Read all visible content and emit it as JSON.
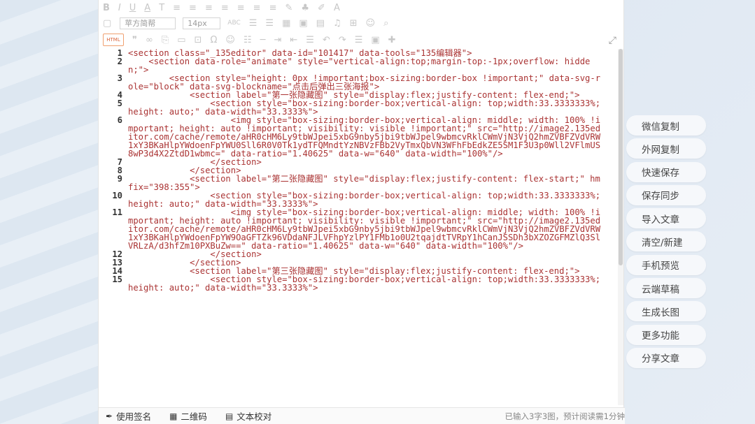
{
  "toolbar": {
    "row1": [
      "B",
      "I",
      "U",
      "A",
      "T",
      "≡",
      "≡",
      "≡",
      "≡",
      "≡",
      "≡",
      "≡",
      "✎",
      "♣",
      "✐",
      "A"
    ],
    "font_family": "苹方简帮",
    "font_size": "14px",
    "abc": "ABC",
    "html_badge": "HTML"
  },
  "code_lines": [
    {
      "n": "1",
      "text": "<section class=\"_135editor\" data-id=\"101417\" data-tools=\"135编辑器\">"
    },
    {
      "n": "2",
      "text": "    <section data-role=\"animate\" style=\"vertical-align:top;margin-top:-1px;overflow: hidden;\">"
    },
    {
      "n": "3",
      "text": "        <section style=\"height: 0px !important;box-sizing:border-box !important;\" data-svg-role=\"block\" data-svg-blockname=\"点击后弹出三张海报\">"
    },
    {
      "n": "4",
      "text": "            <section label=\"第一张隐藏图\" style=\"display:flex;justify-content: flex-end;\">"
    },
    {
      "n": "5",
      "text": "                <section style=\"box-sizing:border-box;vertical-align: top;width:33.3333333%;height: auto;\" data-width=\"33.3333%\">"
    },
    {
      "n": "6",
      "text": "                    <img style=\"box-sizing:border-box;vertical-align: middle; width: 100% !important; height: auto !important; visibility: visible !important;\" src=\"http://image2.135editor.com/cache/remote/aHR0cHM6Ly9tbWJpei5xbG9nby5jbi9tbWJpel9wbmcvRklCWmVjN3VjQ2hmZVBFZVdVRW1xY3BKaHlpYWdoenFpYWU0Sll6R0V0Tk1ydTFQMndtYzNBVzFBb2VyTmxQbVN3WFhFbEdkZE5SM1F3U3p0Wll2VFlmUS8wP3d4X2ZtdD1wbmc=\" data-ratio=\"1.40625\" data-w=\"640\" data-width=\"100%\"/>"
    },
    {
      "n": "7",
      "text": "                </section>"
    },
    {
      "n": "8",
      "text": "            </section>"
    },
    {
      "n": "9",
      "text": "            <section label=\"第二张隐藏图\" style=\"display:flex;justify-content: flex-start;\" hm fix=\"398:355\">"
    },
    {
      "n": "10",
      "text": "                <section style=\"box-sizing:border-box;vertical-align: top;width:33.3333333%;height: auto;\" data-width=\"33.3333%\">"
    },
    {
      "n": "11",
      "text": "                    <img style=\"box-sizing:border-box;vertical-align: middle; width: 100% !important; height: auto !important; visibility: visible !important;\" src=\"http://image2.135editor.com/cache/remote/aHR0cHM6Ly9tbWJpei5xbG9nby5jbi9tbWJpel9wbmcvRklCWmVjN3VjQ2hmZVBFZVdVRW1xY3BKaHlpYWdoenFpYW9OaGFTZk96VDdaNFJLVFhpYzlPY1FMb1o0U2tqajdtTVRpY1hCanJSSDh3bXZOZGFMZlQ3SlVRLzA/d3hfZm10PXBuZw==\" data-ratio=\"1.40625\" data-w=\"640\" data-width=\"100%\"/>"
    },
    {
      "n": "12",
      "text": "                </section>"
    },
    {
      "n": "13",
      "text": "            </section>"
    },
    {
      "n": "14",
      "text": "            <section label=\"第三张隐藏图\" style=\"display:flex;justify-content: flex-end;\">"
    },
    {
      "n": "15",
      "text": "                <section style=\"box-sizing:border-box;vertical-align: top;width:33.3333333%;height: auto;\" data-width=\"33.3333%\">"
    }
  ],
  "statusbar": {
    "signature": "使用签名",
    "qrcode": "二维码",
    "proofread": "文本校对",
    "count": "已输入3字3图，预计阅读需1分钟"
  },
  "side_buttons": [
    "微信复制",
    "外网复制",
    "快速保存",
    "保存同步",
    "导入文章",
    "清空/新建",
    "手机预览",
    "云端草稿",
    "生成长图",
    "更多功能",
    "分享文章"
  ]
}
